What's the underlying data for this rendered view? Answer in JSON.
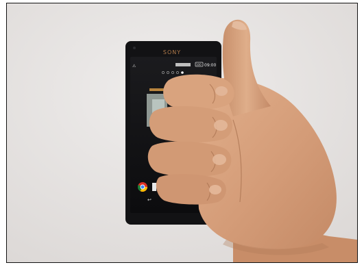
{
  "photo": {
    "phone": {
      "brand": "SONY",
      "status_time": "09:00",
      "battery_level": "100",
      "warning_glyph": "⚠",
      "back_glyph": "↩"
    },
    "colors": {
      "wall": "#e9e7e6",
      "phone_body": "#111113",
      "skin": "#d7a27e",
      "skin_shadow": "#b57e5c",
      "border": "#111111"
    }
  }
}
